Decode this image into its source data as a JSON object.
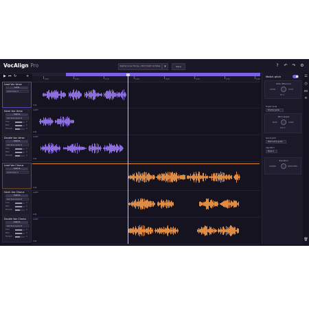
{
  "app": {
    "name": "VocAlign",
    "edition": "Pro"
  },
  "header": {
    "preset": "Slightly Loose Timing + Pitch Match All Notes",
    "save_label": "Save",
    "icons": [
      "help-icon",
      "undo-icon",
      "redo-icon",
      "settings-icon"
    ]
  },
  "timeline": {
    "ticks": [
      "0:05",
      "0:10",
      "0:15",
      "0:20",
      "0:25",
      "0:30",
      "0:35",
      "0:40"
    ]
  },
  "tracks": [
    {
      "name": "Lead Vox Verse",
      "role": "Guide",
      "scale": "Guide Scale: 0",
      "color": "#9a78f0"
    },
    {
      "name": "Harm Vox Verse",
      "role": "Capture",
      "scale": "Dub Track Guide: B",
      "params": [
        {
          "label": "Time",
          "value": "0"
        },
        {
          "label": "Pitch",
          "value": "0"
        },
        {
          "label": "Formant",
          "value": "0"
        }
      ],
      "color": "#9a78f0"
    },
    {
      "name": "Double Vox Verse",
      "role": "Capture",
      "scale": "Dub Track Guide: B",
      "params": [
        {
          "label": "Time",
          "value": "0"
        },
        {
          "label": "Pitch",
          "value": "0"
        },
        {
          "label": "Formant",
          "value": "0"
        }
      ],
      "color": "#9a78f0"
    },
    {
      "name": "Lead Vox Chorus",
      "role": "Capture",
      "scale": "Guide Scale: 0",
      "color": "#f39a4a"
    },
    {
      "name": "Harm Vox Chorus",
      "role": "Capture",
      "scale": "Dub Track Guide: B",
      "params": [
        {
          "label": "Time",
          "value": "0"
        },
        {
          "label": "Pitch",
          "value": "0"
        },
        {
          "label": "Formant",
          "value": "0"
        }
      ],
      "color": "#f39a4a"
    },
    {
      "name": "Double Vox Chorus",
      "role": "Capture",
      "scale": "Dub Track Guide: B",
      "params": [
        {
          "label": "Time",
          "value": "0"
        },
        {
          "label": "Pitch",
          "value": "0"
        },
        {
          "label": "Formant",
          "value": "0"
        }
      ],
      "color": "#f39a4a"
    }
  ],
  "lane_labels": {
    "guide": "GUIDE",
    "dub": "DUB"
  },
  "right_panel": {
    "title": "Match pitch",
    "enabled": true,
    "sections": {
      "note_diff": {
        "heading": "Note difference",
        "left": "LOOSE",
        "right": "TIGHT",
        "value": "50 %"
      },
      "target_mode_label": "Target mode",
      "target_mode": "Shadow guide",
      "pitch_target": {
        "heading": "Pitch target",
        "left": "NOTE",
        "right": "GUIDE",
        "value": "100 %"
      },
      "smart_pitch_label": "Smart pitch",
      "smart_pitch": "Match all to guide",
      "algorithm_label": "Algorithm",
      "algorithm": "Mode 2",
      "transition": {
        "heading": "Transition",
        "left": "LOOSER",
        "right": "SMOOTHER"
      }
    }
  }
}
